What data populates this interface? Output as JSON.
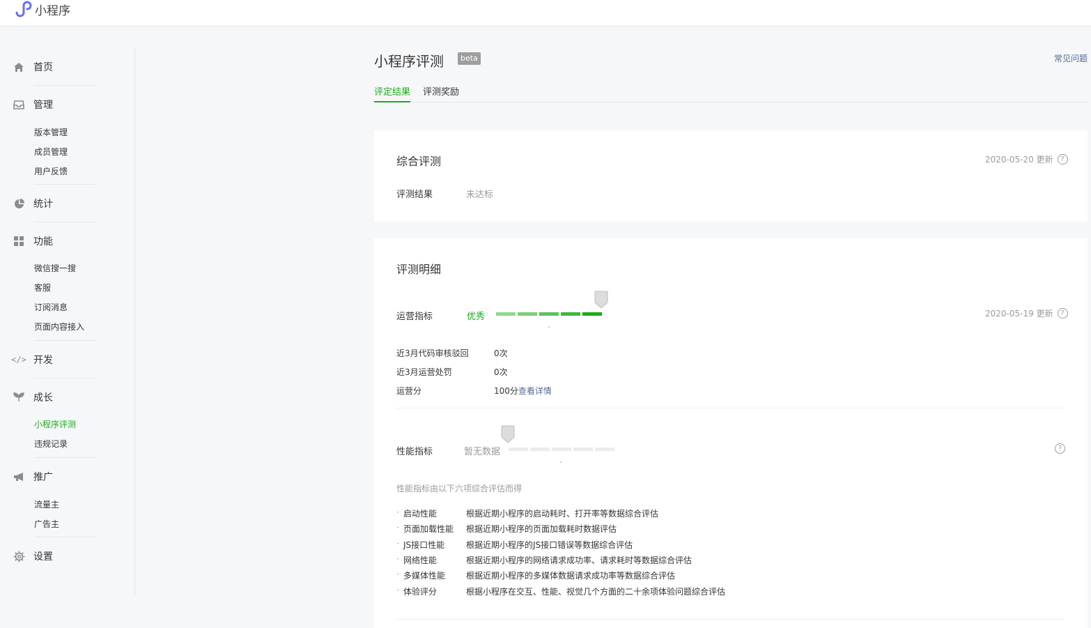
{
  "app": {
    "name": "小程序"
  },
  "nav": {
    "home": "首页",
    "manage": "管理",
    "manage_items": [
      "版本管理",
      "成员管理",
      "用户反馈"
    ],
    "stats": "统计",
    "features": "功能",
    "features_items": [
      "微信搜一搜",
      "客服",
      "订阅消息",
      "页面内容接入"
    ],
    "dev": "开发",
    "growth": "成长",
    "growth_items": [
      "小程序评测",
      "违规记录"
    ],
    "promote": "推广",
    "promote_items": [
      "流量主",
      "广告主"
    ],
    "settings": "设置"
  },
  "page": {
    "title": "小程序评测",
    "badge": "beta",
    "faq": "常见问题",
    "tabs": [
      "评定结果",
      "评测奖励"
    ]
  },
  "overall": {
    "title": "综合评测",
    "date": "2020-05-20 更新",
    "result_label": "评测结果",
    "result_value": "未达标"
  },
  "detail": {
    "title": "评测明细",
    "ops": {
      "label": "运营指标",
      "grade": "优秀",
      "date": "2020-05-19 更新",
      "level": 5,
      "levels_total": 5,
      "dash": "-",
      "rows": [
        {
          "k": "近3月代码审核驳回",
          "v": "0次"
        },
        {
          "k": "近3月运营处罚",
          "v": "0次"
        },
        {
          "k": "运营分",
          "v": "100分",
          "link": "查看详情"
        }
      ]
    },
    "perf": {
      "label": "性能指标",
      "grade": "暂无数据",
      "dash": "-",
      "note": "性能指标由以下六项综合评估而得",
      "items": [
        {
          "k": "启动性能",
          "v": "根据近期小程序的启动耗时、打开率等数据综合评估"
        },
        {
          "k": "页面加载性能",
          "v": "根据近期小程序的页面加载耗时数据评估"
        },
        {
          "k": "JS接口性能",
          "v": "根据近期小程序的JS接口错误等数据综合评估"
        },
        {
          "k": "网络性能",
          "v": "根据近期小程序的网络请求成功率、请求耗时等数据综合评估"
        },
        {
          "k": "多媒体性能",
          "v": "根据近期小程序的多媒体数据请求成功率等数据综合评估"
        },
        {
          "k": "体验评分",
          "v": "根据小程序在交互、性能、视觉几个方面的二十余项体验问题综合评估"
        }
      ]
    }
  },
  "colors": {
    "accent": "#1aad19",
    "link": "#576b95",
    "muted": "#9a9a9a"
  }
}
